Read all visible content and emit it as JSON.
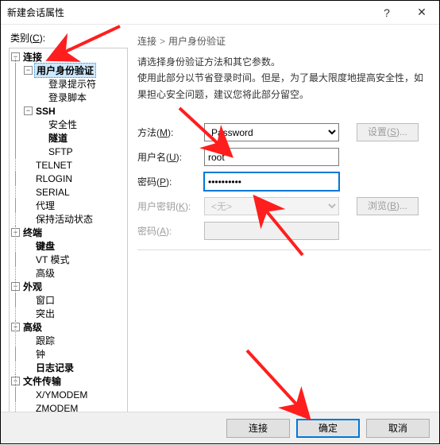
{
  "window": {
    "title": "新建会话属性",
    "help_glyph": "?",
    "close_glyph": "✕"
  },
  "left": {
    "category_label_prefix": "类别",
    "category_label_accel": "C",
    "category_label_suffix": ":",
    "tree": {
      "connect": "连接",
      "auth": "用户身份验证",
      "login_prompt": "登录提示符",
      "login_script": "登录脚本",
      "ssh": "SSH",
      "security": "安全性",
      "tunnel": "隧道",
      "sftp": "SFTP",
      "telnet": "TELNET",
      "rlogin": "RLOGIN",
      "serial": "SERIAL",
      "proxy": "代理",
      "keepalive": "保持活动状态",
      "terminal": "终端",
      "keyboard": "键盘",
      "vtmode": "VT 模式",
      "advanced_term": "高级",
      "appearance": "外观",
      "window": "窗口",
      "highlight": "突出",
      "advanced": "高级",
      "trace": "跟踪",
      "bell": "钟",
      "logging": "日志记录",
      "filetransfer": "文件传输",
      "xymodem": "X/YMODEM",
      "zmodem": "ZMODEM"
    }
  },
  "right": {
    "breadcrumb_root": "连接",
    "breadcrumb_leaf": "用户身份验证",
    "desc_line1": "请选择身份验证方法和其它参数。",
    "desc_line2": "使用此部分以节省登录时间。但是，为了最大限度地提高安全性，如果担心安全问题，建议您将此部分留空。",
    "labels": {
      "method_prefix": "方法(",
      "method_accel": "M",
      "method_suffix": "):",
      "username_prefix": "用户名(",
      "username_accel": "U",
      "username_suffix": "):",
      "password_prefix": "密码(",
      "password_accel": "P",
      "password_suffix": "):",
      "userkey_prefix": "用户密钥(",
      "userkey_accel": "K",
      "userkey_suffix": "):",
      "passphrase_prefix": "密码(",
      "passphrase_accel": "A",
      "passphrase_suffix": "):"
    },
    "method_value": "Password",
    "username_value": "root",
    "password_value": "••••••••••",
    "userkey_value": "<无>",
    "passphrase_value": "",
    "settings_btn_prefix": "设置(",
    "settings_btn_accel": "S",
    "settings_btn_suffix": ")...",
    "browse_btn_prefix": "浏览(",
    "browse_btn_accel": "B",
    "browse_btn_suffix": ")..."
  },
  "footer": {
    "connect": "连接",
    "ok": "确定",
    "cancel": "取消"
  },
  "annotations": {
    "arrow_color": "#ff1e1e"
  }
}
